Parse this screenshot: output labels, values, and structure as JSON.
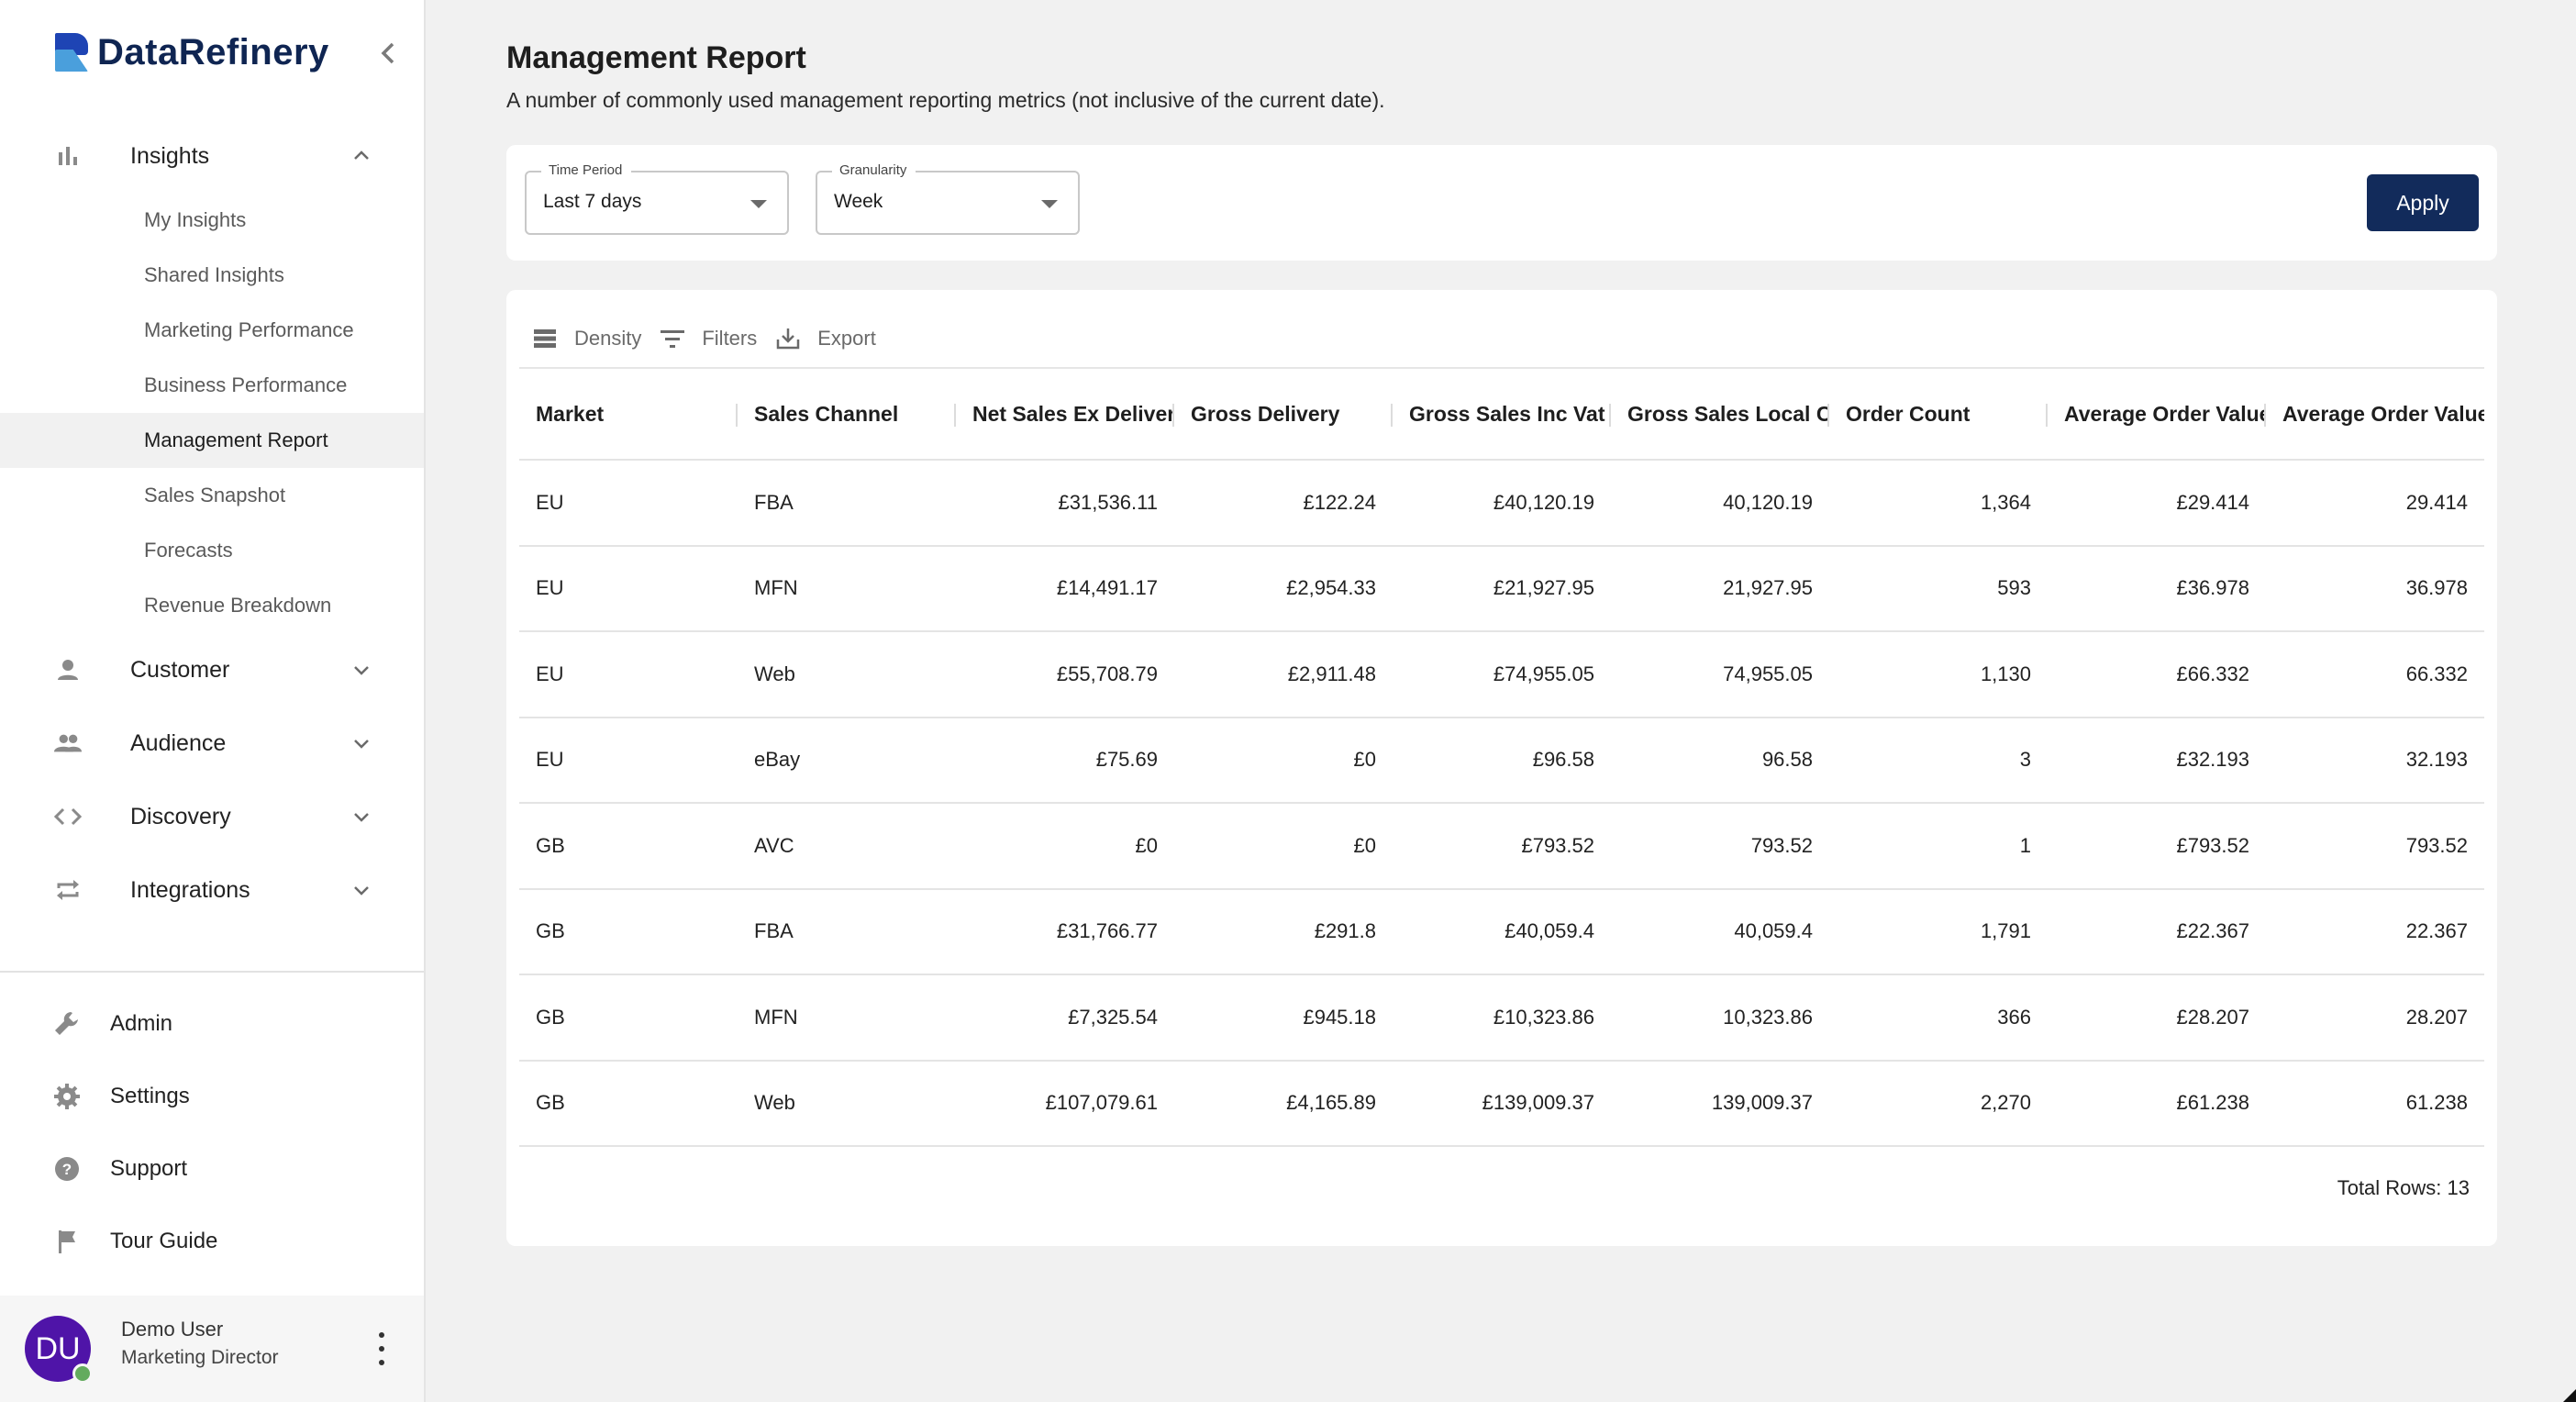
{
  "app": {
    "name": "DataRefinery",
    "collapse_icon": "chevron-left-icon"
  },
  "sidebar": {
    "groups": [
      {
        "label": "Insights",
        "icon": "bar-chart-icon",
        "expanded": true,
        "items": [
          {
            "label": "My Insights",
            "active": false
          },
          {
            "label": "Shared Insights",
            "active": false
          },
          {
            "label": "Marketing Performance",
            "active": false
          },
          {
            "label": "Business Performance",
            "active": false
          },
          {
            "label": "Management Report",
            "active": true
          },
          {
            "label": "Sales Snapshot",
            "active": false
          },
          {
            "label": "Forecasts",
            "active": false
          },
          {
            "label": "Revenue Breakdown",
            "active": false
          }
        ]
      },
      {
        "label": "Customer",
        "icon": "person-icon",
        "expanded": false
      },
      {
        "label": "Audience",
        "icon": "group-icon",
        "expanded": false
      },
      {
        "label": "Discovery",
        "icon": "code-icon",
        "expanded": false
      },
      {
        "label": "Integrations",
        "icon": "sync-icon",
        "expanded": false
      }
    ],
    "bottom_items": [
      {
        "label": "Admin",
        "icon": "wrench-icon"
      },
      {
        "label": "Settings",
        "icon": "gear-icon"
      },
      {
        "label": "Support",
        "icon": "help-icon"
      },
      {
        "label": "Tour Guide",
        "icon": "flag-icon"
      }
    ],
    "user": {
      "initials": "DU",
      "name": "Demo User",
      "role": "Marketing Director",
      "status_color": "#63ab5e",
      "avatar_color": "#4f14a8"
    }
  },
  "page": {
    "title": "Management Report",
    "subtitle": "A number of commonly used management reporting metrics (not inclusive of the current date)."
  },
  "filters": {
    "time_period": {
      "label": "Time Period",
      "value": "Last 7 days"
    },
    "granularity": {
      "label": "Granularity",
      "value": "Week"
    },
    "apply_label": "Apply",
    "apply_color": "#122b5b"
  },
  "toolbar": {
    "density": "Density",
    "filters": "Filters",
    "export": "Export"
  },
  "table": {
    "columns": [
      "Market",
      "Sales Channel",
      "Net Sales Ex Delivery",
      "Gross Delivery",
      "Gross Sales Inc Vat",
      "Gross Sales Local Currency",
      "Order Count",
      "Average Order Value",
      "Average Order Value"
    ],
    "rows": [
      [
        "EU",
        "FBA",
        "£31,536.11",
        "£122.24",
        "£40,120.19",
        "40,120.19",
        "1,364",
        "£29.414",
        "29.414"
      ],
      [
        "EU",
        "MFN",
        "£14,491.17",
        "£2,954.33",
        "£21,927.95",
        "21,927.95",
        "593",
        "£36.978",
        "36.978"
      ],
      [
        "EU",
        "Web",
        "£55,708.79",
        "£2,911.48",
        "£74,955.05",
        "74,955.05",
        "1,130",
        "£66.332",
        "66.332"
      ],
      [
        "EU",
        "eBay",
        "£75.69",
        "£0",
        "£96.58",
        "96.58",
        "3",
        "£32.193",
        "32.193"
      ],
      [
        "GB",
        "AVC",
        "£0",
        "£0",
        "£793.52",
        "793.52",
        "1",
        "£793.52",
        "793.52"
      ],
      [
        "GB",
        "FBA",
        "£31,766.77",
        "£291.8",
        "£40,059.4",
        "40,059.4",
        "1,791",
        "£22.367",
        "22.367"
      ],
      [
        "GB",
        "MFN",
        "£7,325.54",
        "£945.18",
        "£10,323.86",
        "10,323.86",
        "366",
        "£28.207",
        "28.207"
      ],
      [
        "GB",
        "Web",
        "£107,079.61",
        "£4,165.89",
        "£139,009.37",
        "139,009.37",
        "2,270",
        "£61.238",
        "61.238"
      ]
    ],
    "total_rows_label": "Total Rows: 13"
  },
  "chat": {
    "icon": "chat-bubbles-icon",
    "color": "#142c5c"
  }
}
